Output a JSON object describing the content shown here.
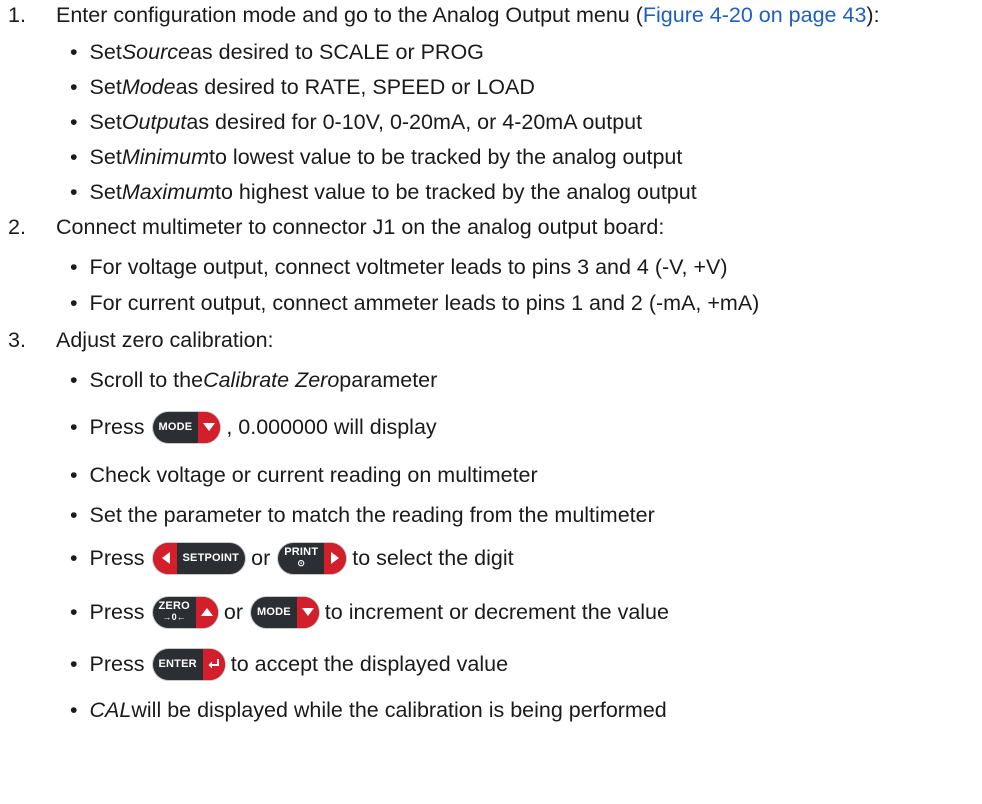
{
  "step1": {
    "num": "1.",
    "pre": "Enter configuration mode and go to the Analog Output menu (",
    "link": "Figure 4-20 on page 43",
    "post": "):",
    "b1": {
      "pre": "Set ",
      "em": "Source",
      "post": " as desired to SCALE or PROG"
    },
    "b2": {
      "pre": "Set ",
      "em": "Mode",
      "post": " as desired to RATE, SPEED or LOAD"
    },
    "b3": {
      "pre": "Set ",
      "em": "Output",
      "post": " as desired for 0-10V, 0-20mA, or 4-20mA output"
    },
    "b4": {
      "pre": "Set ",
      "em": "Minimum",
      "post": " to lowest value to be tracked by the analog output"
    },
    "b5": {
      "pre": "Set ",
      "em": "Maximum",
      "post": " to highest value to be tracked by the analog output"
    }
  },
  "step2": {
    "num": "2.",
    "text": "Connect multimeter to connector J1 on the analog output board:",
    "b1": "For voltage output, connect voltmeter leads to pins 3 and 4 (-V, +V)",
    "b2": "For current output, connect ammeter leads to pins 1 and 2 (-mA, +mA)"
  },
  "step3": {
    "num": "3.",
    "text": "Adjust zero calibration:",
    "b1": {
      "pre": "Scroll to the ",
      "em": "Calibrate Zero",
      "post": " parameter"
    },
    "b2": {
      "pre": "Press",
      "post": ", 0.000000 will display"
    },
    "b3": "Check voltage or current reading on multimeter",
    "b4": "Set the parameter to match the reading from the multimeter",
    "b5": {
      "pre": "Press",
      "mid": "or",
      "post": "to select the digit"
    },
    "b6": {
      "pre": "Press",
      "mid": "or",
      "post": "to increment or decrement the value"
    },
    "b7": {
      "pre": "Press",
      "post": "to accept the displayed value"
    },
    "b8": {
      "em": "CAL",
      "post": " will be displayed while the calibration is being performed"
    }
  },
  "buttons": {
    "mode": "MODE",
    "setpoint": "SETPOINT",
    "print": "PRINT",
    "print_sub": "⊙",
    "zero": "ZERO",
    "zero_sub": "→0←",
    "enter": "ENTER"
  },
  "bullet": "•",
  "colors": {
    "link": "#1f5fbf",
    "button_body": "#2b2f33",
    "button_arrow": "#d21f2b"
  }
}
